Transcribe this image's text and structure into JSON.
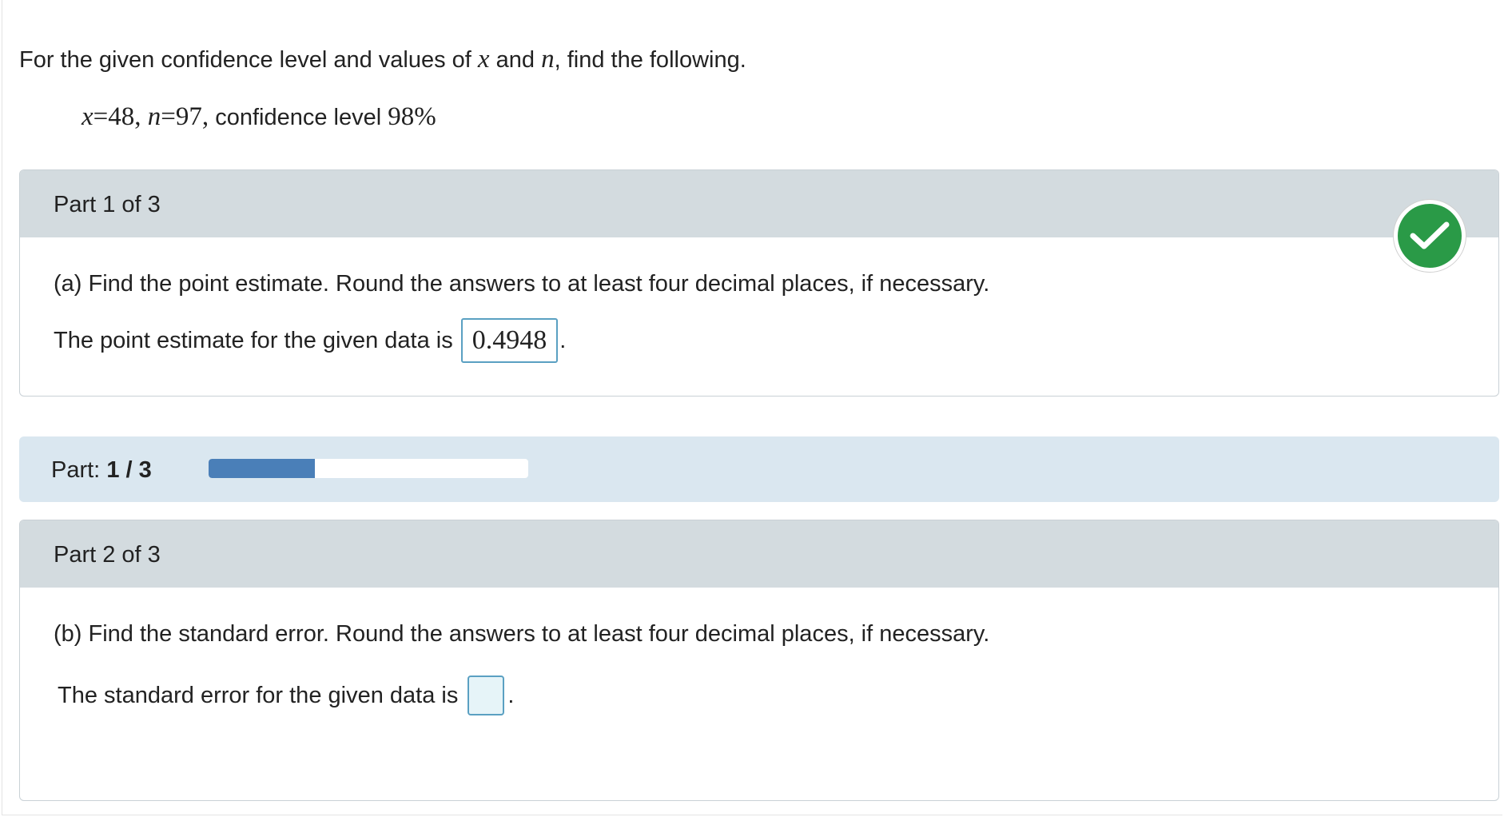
{
  "intro": {
    "before": "For the given confidence level and values of ",
    "var_x": "x",
    "and": " and ",
    "var_n": "n",
    "after": ", find the following."
  },
  "given": {
    "x_var": "x",
    "x_eq": "=48, ",
    "n_var": "n",
    "n_eq": "=97,",
    "conf_text": " confidence level ",
    "conf_value": "98%"
  },
  "part1": {
    "header": "Part 1 of 3",
    "question": "(a) Find the point estimate. Round the answers to at least four decimal places, if necessary.",
    "answer_prefix": "The point estimate for the given data is",
    "answer_value": "0.4948",
    "answer_suffix": ".",
    "status": "correct",
    "status_icon": "checkmark-icon",
    "status_color": "#2a9a47"
  },
  "progress": {
    "label": "Part:",
    "current": "1 / 3",
    "fraction": 0.3333,
    "fill_color": "#4a7fb8"
  },
  "part2": {
    "header": "Part 2 of 3",
    "question": "(b) Find the standard error. Round the answers to at least four decimal places, if necessary.",
    "answer_prefix": "The standard error for the given data is",
    "answer_value": "",
    "answer_suffix": "."
  }
}
